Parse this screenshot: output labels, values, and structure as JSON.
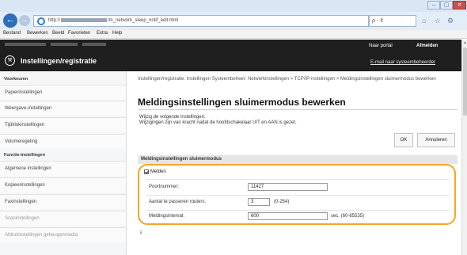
{
  "browser": {
    "url_prefix": "http://",
    "url_suffix": "/m_network_sleep_notif_edit.html",
    "search_placeholder": "ρ - ¢"
  },
  "menu": [
    "Bestand",
    "Bewerken",
    "Beeld",
    "Favorieten",
    "Extra",
    "Help"
  ],
  "header": {
    "app_title": "Instellingen/registratie",
    "portal_link": "Naar portal",
    "logout_link": "Afmelden",
    "email_link": "E-mail naar systeembeheerder"
  },
  "sidebar": {
    "section1_title": "Voorkeuren",
    "section1_items": [
      "Papierinstellingen",
      "Weergave-instellingen",
      "Tijdklokinstellingen",
      "Volumeregeling"
    ],
    "section2_title": "Functie-instellingen",
    "section2_items": [
      "Algemene instellingen",
      "Kopieerinstellingen",
      "Faxinstellingen",
      "Scaninstellingen",
      "Afdrukinstellingen geheugenmedia"
    ]
  },
  "main": {
    "breadcrumb": "Instellingen/registratie: Instellingen Systeembeheer: Netwerkinstellingen > TCP/IP-instellingen > Meldingsinstellingen sluimermodus bewerken",
    "title": "Meldingsinstellingen sluimermodus bewerken",
    "instruction_1": "Wijzig de volgende instellingen.",
    "instruction_2": "Wijzigingen zijn van kracht nadat de hoofdschakelaar UIT en AAN is gezet.",
    "ok_label": "OK",
    "cancel_label": "Annuleren",
    "section_title": "Meldingsinstellingen sluimermodus",
    "notify_label": "Melden",
    "notify_checked": true,
    "port_label": "Poortnummer:",
    "port_value": "11427",
    "routers_label": "Aantal te passeren routers:",
    "routers_value": "3",
    "routers_range": "(0-254)",
    "interval_label": "Meldingsinterval:",
    "interval_value": "600",
    "interval_unit": "sec. (60-65535)",
    "footer_mark": "⊼"
  }
}
